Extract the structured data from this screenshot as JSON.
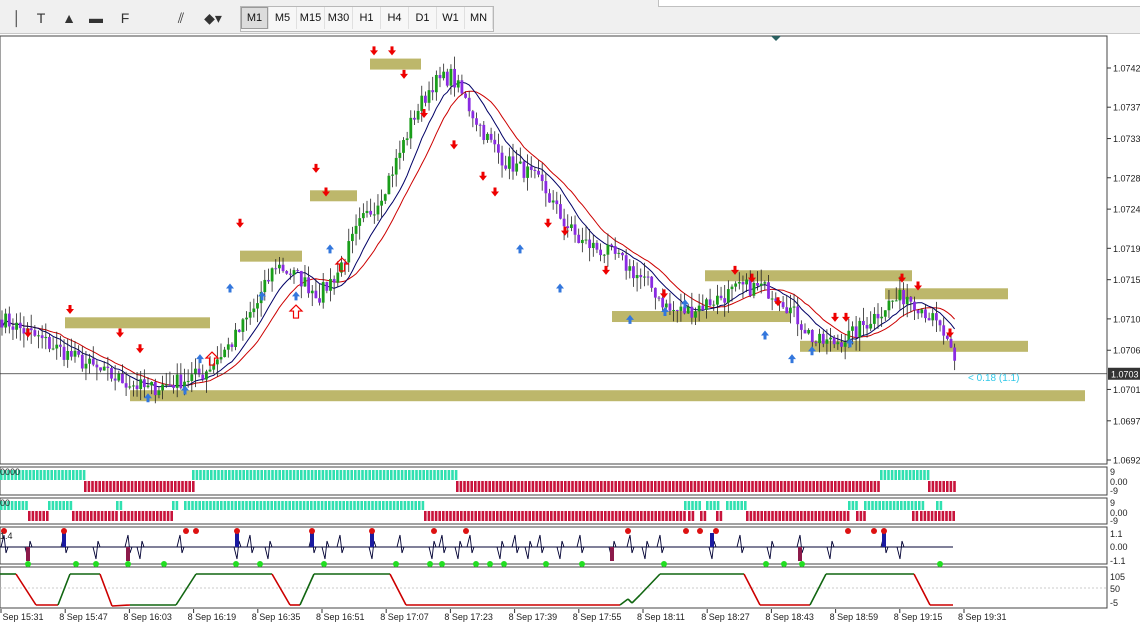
{
  "toolbar": {
    "tools": [
      {
        "name": "cursor-tool-button",
        "glyph": "│"
      },
      {
        "name": "text-tool-button",
        "glyph": "T"
      },
      {
        "name": "triangle-tool-button",
        "glyph": "▲"
      },
      {
        "name": "rectangle-tool-button",
        "glyph": "▬"
      },
      {
        "name": "fibonacci-tool-button",
        "glyph": "F"
      },
      {
        "name": "channel-tool-button",
        "glyph": "⫽"
      },
      {
        "name": "shapes-menu-button",
        "glyph": "◆▾"
      }
    ],
    "timeframes": [
      "M1",
      "M5",
      "M15",
      "M30",
      "H1",
      "H4",
      "D1",
      "W1",
      "MN"
    ],
    "active_timeframe": "M1"
  },
  "price_axis": {
    "labels": [
      "1.0742",
      "1.0737",
      "1.0733",
      "1.0728",
      "1.0724",
      "1.0719",
      "1.0715",
      "1.0710",
      "1.0706",
      "1.0701",
      "1.0697",
      "1.0692"
    ],
    "current_price": "1.0703"
  },
  "time_axis": {
    "labels": [
      "8 Sep 15:31",
      "8 Sep 15:47",
      "8 Sep 16:03",
      "8 Sep 16:19",
      "8 Sep 16:35",
      "8 Sep 16:51",
      "8 Sep 17:07",
      "8 Sep 17:23",
      "8 Sep 17:39",
      "8 Sep 17:55",
      "8 Sep 18:11",
      "8 Sep 18:27",
      "8 Sep 18:43",
      "8 Sep 18:59",
      "8 Sep 19:15",
      "8 Sep 19:31"
    ]
  },
  "annotations": {
    "spread_label": "< 0.18 (1.1)"
  },
  "subwindows": {
    "ind1": {
      "left_label": "0000",
      "scale": [
        "9",
        "0.00",
        "-9"
      ]
    },
    "ind2": {
      "left_label": "00",
      "scale": [
        "9",
        "0.00",
        "-9"
      ]
    },
    "ind3": {
      "left_label": "1.4",
      "scale": [
        "1.1",
        "0.00",
        "-1.1"
      ]
    },
    "ind4": {
      "scale": [
        "105",
        "50",
        "-5"
      ]
    }
  },
  "colors": {
    "bull_candle": "#1a9e1a",
    "bear_candle": "#8a2be2",
    "ma_fast": "#000066",
    "ma_slow": "#cc0000",
    "zone": "#bdb76b",
    "bar_up": "#30e0b0",
    "bar_down": "#c8143c",
    "arrow_down": "#ee0000",
    "arrow_up": "#3377dd",
    "spread": "#30c8e8"
  },
  "chart_data": {
    "type": "candlestick",
    "symbol": "",
    "timeframe": "M1",
    "ylim": [
      1.069,
      1.0746
    ],
    "x_tick_labels": [
      "8 Sep 15:31",
      "8 Sep 15:47",
      "8 Sep 16:03",
      "8 Sep 16:19",
      "8 Sep 16:35",
      "8 Sep 16:51",
      "8 Sep 17:07",
      "8 Sep 17:23",
      "8 Sep 17:39",
      "8 Sep 17:55",
      "8 Sep 18:11",
      "8 Sep 18:27",
      "8 Sep 18:43",
      "8 Sep 18:59",
      "8 Sep 19:15",
      "8 Sep 19:31"
    ],
    "close_path": [
      [
        0,
        1.071
      ],
      [
        8,
        1.0708
      ],
      [
        16,
        1.0706
      ],
      [
        28,
        1.0703
      ],
      [
        40,
        1.0701
      ],
      [
        48,
        1.0702
      ],
      [
        55,
        1.0703
      ],
      [
        63,
        1.0707
      ],
      [
        70,
        1.0712
      ],
      [
        75,
        1.0717
      ],
      [
        82,
        1.0715
      ],
      [
        87,
        1.0713
      ],
      [
        92,
        1.0716
      ],
      [
        98,
        1.0722
      ],
      [
        103,
        1.0725
      ],
      [
        108,
        1.073
      ],
      [
        113,
        1.0736
      ],
      [
        118,
        1.074
      ],
      [
        123,
        1.0741
      ],
      [
        128,
        1.0737
      ],
      [
        133,
        1.0733
      ],
      [
        138,
        1.073
      ],
      [
        143,
        1.0729
      ],
      [
        148,
        1.0727
      ],
      [
        153,
        1.0723
      ],
      [
        158,
        1.072
      ],
      [
        163,
        1.0719
      ],
      [
        168,
        1.0718
      ],
      [
        173,
        1.0716
      ],
      [
        178,
        1.0714
      ],
      [
        183,
        1.0711
      ],
      [
        188,
        1.0711
      ],
      [
        193,
        1.0712
      ],
      [
        198,
        1.0713
      ],
      [
        203,
        1.0714
      ],
      [
        208,
        1.0714
      ],
      [
        213,
        1.0713
      ],
      [
        218,
        1.071
      ],
      [
        223,
        1.0707
      ],
      [
        228,
        1.0707
      ],
      [
        233,
        1.0708
      ],
      [
        238,
        1.071
      ],
      [
        243,
        1.0712
      ],
      [
        248,
        1.0713
      ],
      [
        253,
        1.0711
      ],
      [
        258,
        1.0708
      ],
      [
        261,
        1.0704
      ]
    ],
    "zones": [
      {
        "x0": 65,
        "x1": 210,
        "price": 1.07095
      },
      {
        "x0": 370,
        "x1": 421,
        "price": 1.07425
      },
      {
        "x0": 240,
        "x1": 302,
        "price": 1.0718
      },
      {
        "x0": 310,
        "x1": 357,
        "price": 1.07257
      },
      {
        "x0": 130,
        "x1": 1085,
        "price": 1.07002
      },
      {
        "x0": 705,
        "x1": 912,
        "price": 1.07155
      },
      {
        "x0": 612,
        "x1": 790,
        "price": 1.07103
      },
      {
        "x0": 800,
        "x1": 1028,
        "price": 1.07065
      },
      {
        "x0": 885,
        "x1": 1008,
        "price": 1.07132
      }
    ],
    "down_arrows": [
      [
        28,
        1.0708
      ],
      [
        70,
        1.0711
      ],
      [
        120,
        1.0708
      ],
      [
        140,
        1.0706
      ],
      [
        240,
        1.0722
      ],
      [
        316,
        1.0729
      ],
      [
        326,
        1.0726
      ],
      [
        374,
        1.0744
      ],
      [
        392,
        1.0744
      ],
      [
        404,
        1.0741
      ],
      [
        424,
        1.0736
      ],
      [
        454,
        1.0732
      ],
      [
        483,
        1.0728
      ],
      [
        495,
        1.0726
      ],
      [
        548,
        1.0722
      ],
      [
        565,
        1.0721
      ],
      [
        606,
        1.0716
      ],
      [
        664,
        1.0713
      ],
      [
        735,
        1.0716
      ],
      [
        752,
        1.0715
      ],
      [
        778,
        1.0712
      ],
      [
        835,
        1.071
      ],
      [
        846,
        1.071
      ],
      [
        902,
        1.0715
      ],
      [
        918,
        1.0714
      ],
      [
        950,
        1.0708
      ]
    ],
    "up_arrows": [
      [
        148,
        1.07
      ],
      [
        185,
        1.0701
      ],
      [
        200,
        1.0705
      ],
      [
        230,
        1.0714
      ],
      [
        262,
        1.0713
      ],
      [
        296,
        1.0713
      ],
      [
        330,
        1.0719
      ],
      [
        520,
        1.0719
      ],
      [
        560,
        1.0714
      ],
      [
        630,
        1.071
      ],
      [
        665,
        1.0711
      ],
      [
        685,
        1.0712
      ],
      [
        765,
        1.0708
      ],
      [
        792,
        1.0705
      ],
      [
        812,
        1.0706
      ],
      [
        850,
        1.0707
      ]
    ],
    "hollow_up_arrows": [
      [
        212,
        1.0705
      ],
      [
        296,
        1.0711
      ],
      [
        342,
        1.0717
      ]
    ]
  }
}
